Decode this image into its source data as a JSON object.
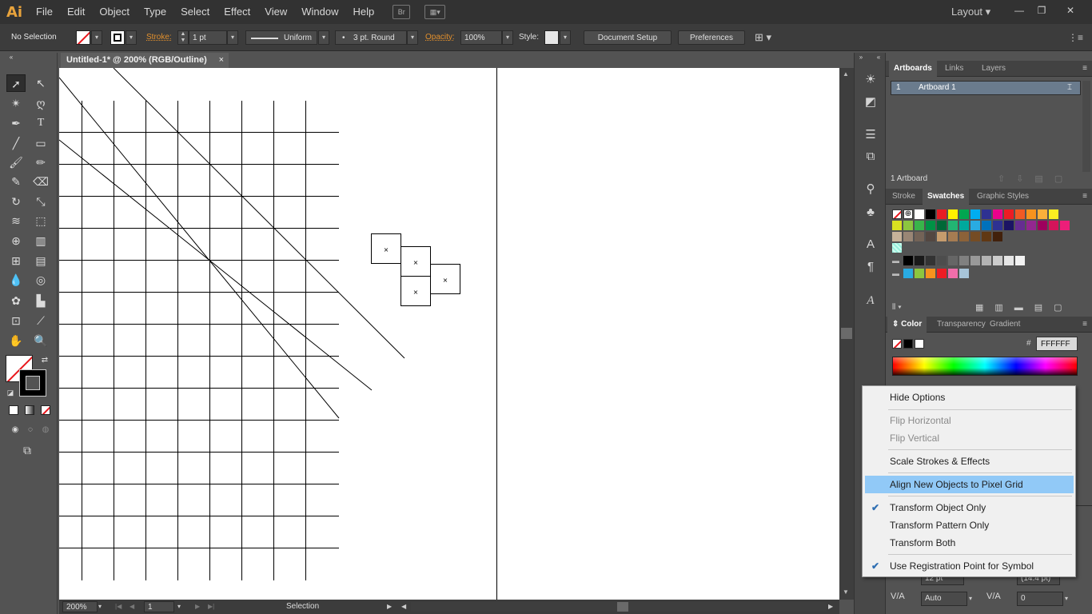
{
  "app": {
    "logo": "Ai",
    "layout_label": "Layout"
  },
  "menubar": {
    "items": [
      "File",
      "Edit",
      "Object",
      "Type",
      "Select",
      "Effect",
      "View",
      "Window",
      "Help"
    ],
    "bridge_icon": "Br"
  },
  "controlbar": {
    "selection_state": "No Selection",
    "stroke_label": "Stroke:",
    "stroke_weight": "1 pt",
    "variable_width_profile": "Uniform",
    "brush_definition": "3 pt. Round",
    "opacity_label": "Opacity:",
    "opacity_value": "100%",
    "style_label": "Style:",
    "document_setup_button": "Document Setup",
    "preferences_button": "Preferences"
  },
  "document": {
    "tab_title": "Untitled-1* @ 200% (RGB/Outline)",
    "close": "×"
  },
  "statusbar": {
    "zoom": "200%",
    "artboard_number": "1",
    "current_tool": "Selection"
  },
  "artboards_panel": {
    "tabs": [
      "Artboards",
      "Links",
      "Layers"
    ],
    "rows": [
      {
        "index": "1",
        "name": "Artboard 1"
      }
    ],
    "footer_count": "1 Artboard"
  },
  "swatches_panel": {
    "tabs": [
      "Stroke",
      "Swatches",
      "Graphic Styles"
    ],
    "row1": [
      "#ffffff",
      "#000000",
      "#e81c24",
      "#fff100",
      "#00a650",
      "#00adef",
      "#2e3192",
      "#ec008c",
      "#ed1c24",
      "#f15a24",
      "#f7931e",
      "#fbb03b",
      "#fcee21"
    ],
    "row2": [
      "#d9e021",
      "#8cc63f",
      "#39b54a",
      "#009245",
      "#006837",
      "#22b573",
      "#00a99d",
      "#29abe2",
      "#0071bc",
      "#2e3192",
      "#1b1464",
      "#662d91",
      "#93278f",
      "#9e005d",
      "#d4145a",
      "#ed1e79"
    ],
    "row3": [
      "#c7b299",
      "#998675",
      "#736357",
      "#534741",
      "#c69c6d",
      "#a67c52",
      "#8c6239",
      "#754c24",
      "#603813",
      "#42210b"
    ],
    "grays": [
      "#000000",
      "#1a1a1a",
      "#333333",
      "#4d4d4d",
      "#666666",
      "#808080",
      "#999999",
      "#b3b3b3",
      "#cccccc",
      "#e6e6e6",
      "#f2f2f2"
    ],
    "brights": [
      "#29abe2",
      "#8cc63f",
      "#f7931e",
      "#ed1c24",
      "#f06eaa",
      "#a7c4d8"
    ]
  },
  "color_panel": {
    "tabs": [
      "Color",
      "Transparency",
      "Gradient"
    ],
    "hex_label": "#",
    "hex_value": "FFFFFF"
  },
  "character_panel": {
    "font_size": "12 pt",
    "leading": "(14.4 pt)",
    "kerning": "Auto",
    "tracking": "0"
  },
  "flyout_menu": {
    "items": [
      {
        "label": "Hide Options",
        "checked": false,
        "disabled": false
      },
      {
        "label": "Flip Horizontal",
        "checked": false,
        "disabled": true
      },
      {
        "label": "Flip Vertical",
        "checked": false,
        "disabled": true
      },
      {
        "label": "Scale Strokes & Effects",
        "checked": false,
        "disabled": false
      },
      {
        "label": "Align New Objects to Pixel Grid",
        "checked": false,
        "disabled": false,
        "highlighted": true
      },
      {
        "label": "Transform Object Only",
        "checked": true,
        "disabled": false
      },
      {
        "label": "Transform Pattern Only",
        "checked": false,
        "disabled": false
      },
      {
        "label": "Transform Both",
        "checked": false,
        "disabled": false
      },
      {
        "label": "Use Registration Point for Symbol",
        "checked": true,
        "disabled": false
      }
    ],
    "check_glyph": "✔"
  },
  "colors": {
    "chrome_dark": "#323232",
    "panel": "#535353",
    "accent_orange": "#e2902d",
    "menu_highlight": "#91c9f7"
  }
}
